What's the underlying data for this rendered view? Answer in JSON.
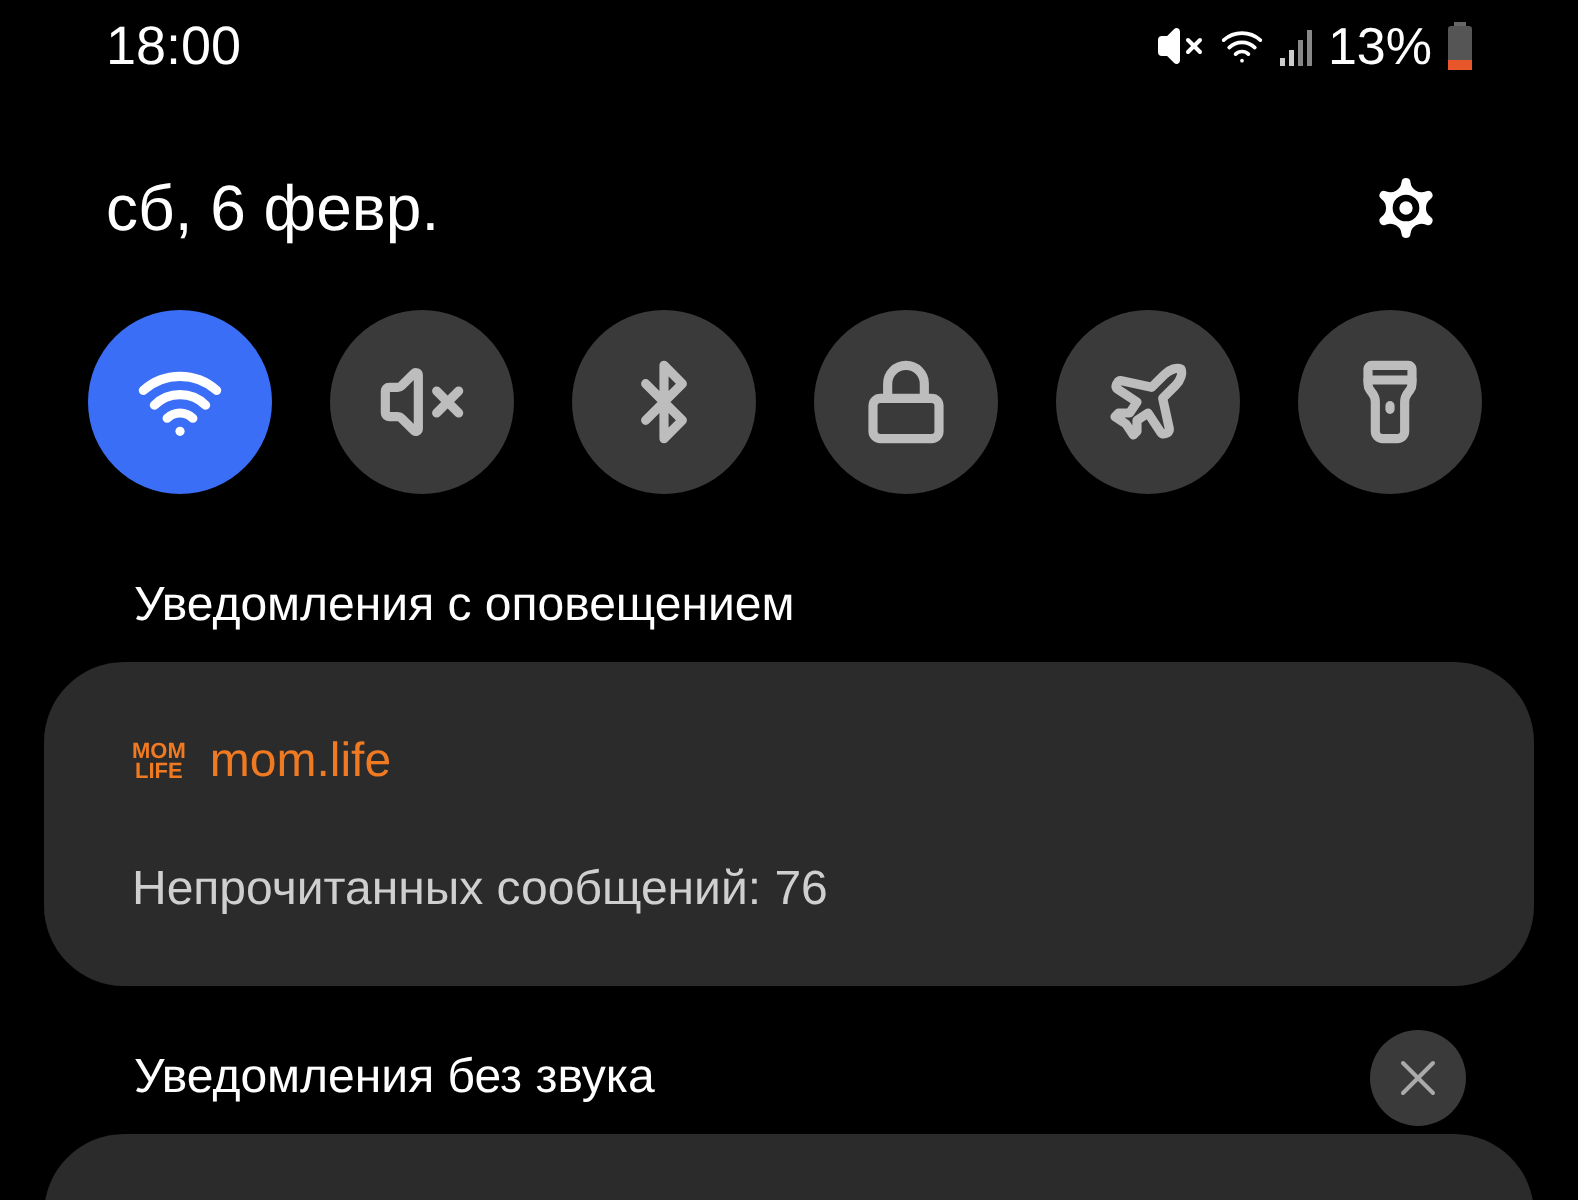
{
  "status_bar": {
    "time": "18:00",
    "battery_text": "13%"
  },
  "date": "сб, 6 февр.",
  "toggles": [
    {
      "kind": "wifi",
      "on": true
    },
    {
      "kind": "sound",
      "on": false
    },
    {
      "kind": "bluetooth",
      "on": false
    },
    {
      "kind": "lock",
      "on": false
    },
    {
      "kind": "airplane",
      "on": false
    },
    {
      "kind": "flashlight",
      "on": false
    }
  ],
  "sections": [
    {
      "title": "Уведомления с оповещением",
      "notifications": [
        {
          "app_logo": [
            "MOM",
            "LIFE"
          ],
          "app": "mom.life",
          "text": "Непрочитанных сообщений: 76"
        }
      ]
    },
    {
      "title": "Уведомления без звука",
      "dismissable": true,
      "notifications": [
        {
          "kind": "cut_off"
        }
      ]
    }
  ]
}
